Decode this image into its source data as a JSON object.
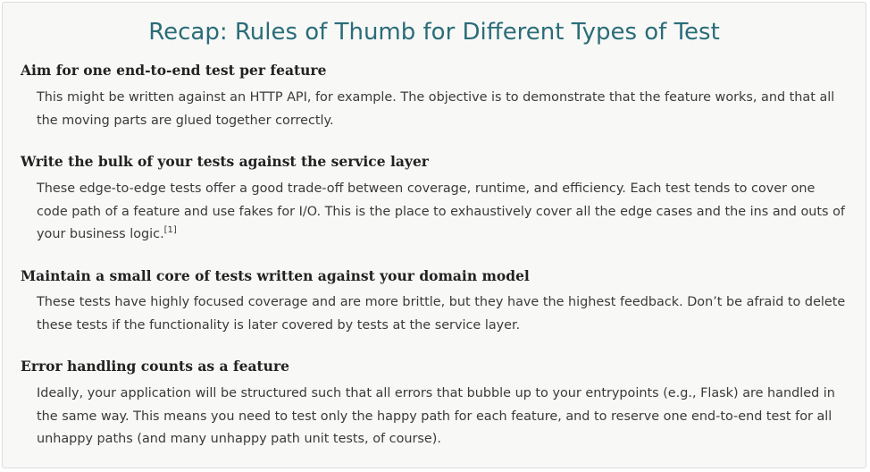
{
  "sidebar": {
    "title": "Recap: Rules of Thumb for Different Types of Test",
    "entries": [
      {
        "term": "Aim for one end-to-end test per feature",
        "lines": [
          "This might be written against an HTTP API, for example. The objective is to demonstrate that the feature works, and that all",
          "the moving parts are glued together correctly."
        ]
      },
      {
        "term": "Write the bulk of your tests against the service layer",
        "lines": [
          "These edge-to-edge tests offer a good trade-off between coverage, runtime, and efficiency. Each test tends to cover one",
          "code path of a feature and use fakes for I/O. This is the place to exhaustively cover all the edge cases and the ins and outs of",
          "your business logic."
        ],
        "footnote": "[1]"
      },
      {
        "term": "Maintain a small core of tests written against your domain model",
        "lines": [
          "These tests have highly focused coverage and are more brittle, but they have the highest feedback. Don’t be afraid to delete",
          "these tests if the functionality is later covered by tests at the service layer."
        ]
      },
      {
        "term": "Error handling counts as a feature",
        "lines": [
          "Ideally, your application will be structured such that all errors that bubble up to your entrypoints (e.g., Flask) are handled in",
          "the same way. This means you need to test only the happy path for each feature, and to reserve one end-to-end test for all",
          "unhappy paths (and many unhappy path unit tests, of course)."
        ]
      }
    ]
  },
  "colors": {
    "title": "#2a6d78",
    "background": "#f8f8f7",
    "border": "#dcdcdc",
    "term": "#222222",
    "body": "#3a3a3a"
  }
}
